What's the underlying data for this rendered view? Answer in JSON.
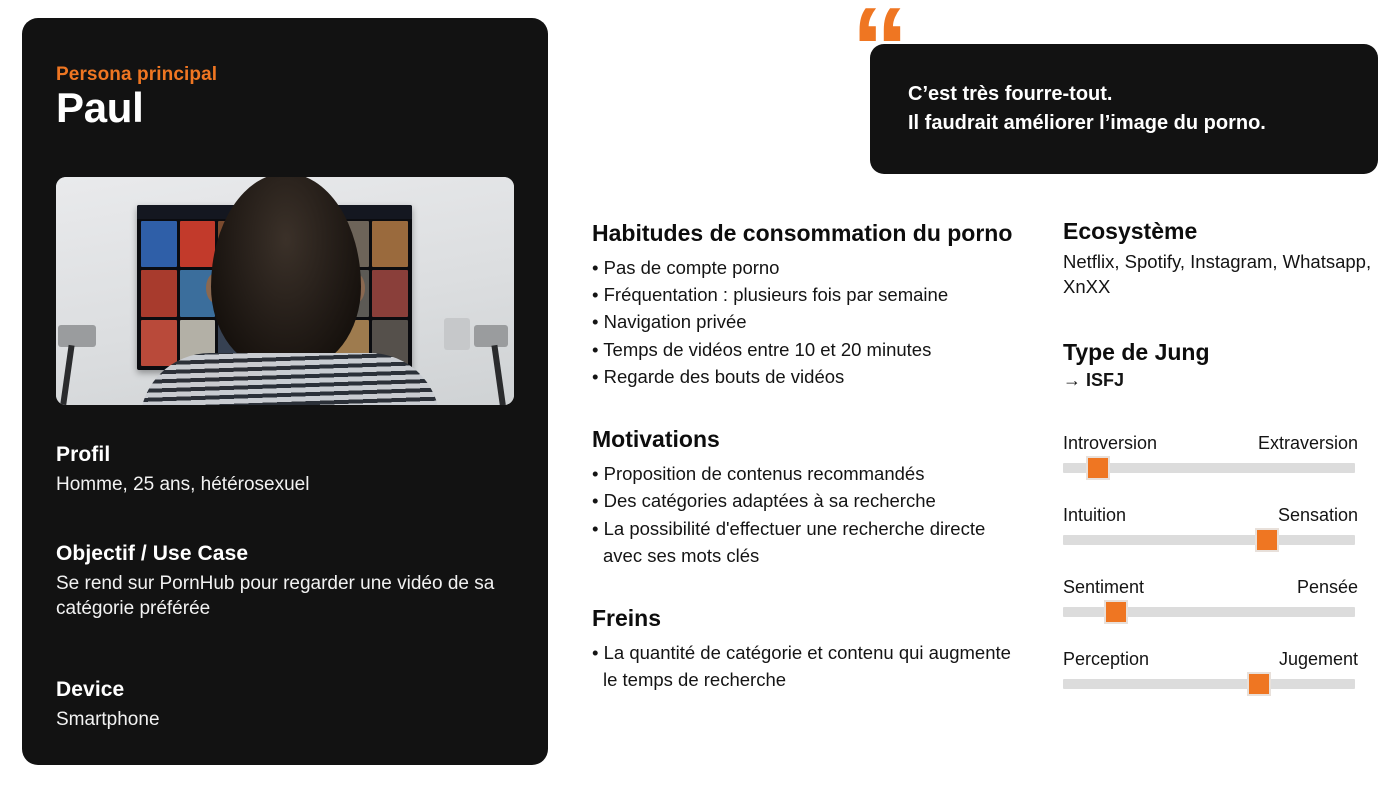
{
  "accent_color": "#EF7622",
  "card_bg": "#121212",
  "persona": {
    "kicker": "Persona principal",
    "name": "Paul",
    "photo_alt": "man-watching-tv-photo",
    "blocks": [
      {
        "heading": "Profil",
        "body": "Homme, 25 ans, hétérosexuel"
      },
      {
        "heading": "Objectif / Use Case",
        "body": "Se rend sur PornHub pour regarder une vidéo de sa catégorie préférée"
      },
      {
        "heading": "Device",
        "body": "Smartphone"
      }
    ]
  },
  "quote": {
    "mark": "“",
    "line1": "C’est très fourre-tout.",
    "line2": "Il faudrait améliorer l’image du porno."
  },
  "middle": {
    "sections": [
      {
        "title": "Habitudes de consommation du porno",
        "items": [
          "• Pas de compte porno",
          "• Fréquentation : plusieurs fois par semaine",
          "• Navigation privée",
          "• Temps de vidéos entre 10 et 20 minutes",
          "• Regarde des bouts de vidéos"
        ]
      },
      {
        "title": "Motivations",
        "items": [
          "• Proposition de contenus recommandés",
          "• Des catégories adaptées à sa recherche",
          "• La possibilité d'effectuer une recherche directe avec ses mots clés"
        ]
      },
      {
        "title": "Freins",
        "items": [
          "• La quantité de catégorie et contenu qui augmente le temps de recherche"
        ]
      }
    ]
  },
  "right": {
    "ecosystem_title": "Ecosystème",
    "ecosystem_body": "Netflix, Spotify, Instagram, Whatsapp, XnXX",
    "jung_title": "Type de Jung",
    "jung_type": "→ ISFJ",
    "sliders": [
      {
        "left_label": "Introversion",
        "right_label": "Extraversion",
        "value": 12
      },
      {
        "left_label": "Intuition",
        "right_label": "Sensation",
        "value": 70
      },
      {
        "left_label": "Sentiment",
        "right_label": "Pensée",
        "value": 18
      },
      {
        "left_label": "Perception",
        "right_label": "Jugement",
        "value": 67
      }
    ]
  }
}
